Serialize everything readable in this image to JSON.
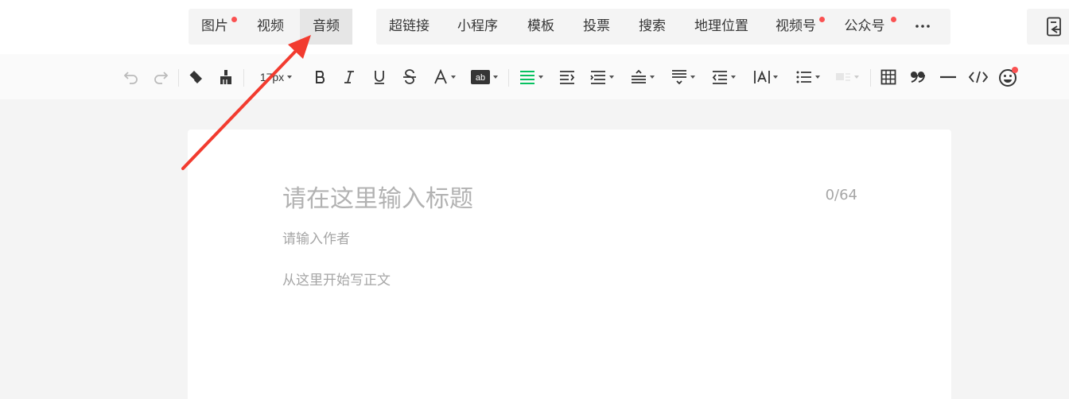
{
  "insert_bar": {
    "media_tabs": [
      {
        "label": "图片",
        "badge": true
      },
      {
        "label": "视频",
        "badge": false
      },
      {
        "label": "音频",
        "badge": false,
        "active": true
      }
    ],
    "more_tabs": [
      {
        "label": "超链接",
        "badge": false
      },
      {
        "label": "小程序",
        "badge": false
      },
      {
        "label": "模板",
        "badge": false
      },
      {
        "label": "投票",
        "badge": false
      },
      {
        "label": "搜索",
        "badge": false
      },
      {
        "label": "地理位置",
        "badge": false
      },
      {
        "label": "视频号",
        "badge": true
      },
      {
        "label": "公众号",
        "badge": true
      }
    ],
    "more_icon": "ellipsis-icon",
    "side_icon": "document-import-icon"
  },
  "toolbar": {
    "font_size": "17px",
    "icons": [
      "undo-icon",
      "redo-icon",
      "eraser-icon",
      "format-brush-icon",
      "bold-icon",
      "italic-icon",
      "underline-icon",
      "strikethrough-icon",
      "font-color-icon",
      "background-color-icon",
      "align-icon",
      "indent-icon",
      "line-height-icon",
      "paragraph-spacing-before-icon",
      "paragraph-spacing-after-icon",
      "first-line-indent-icon",
      "letter-spacing-icon",
      "list-icon",
      "float-icon",
      "table-icon",
      "quote-icon",
      "divider-icon",
      "code-icon",
      "emoji-icon"
    ]
  },
  "editor": {
    "title_placeholder": "请在这里输入标题",
    "title_count": "0/64",
    "author_placeholder": "请输入作者",
    "body_placeholder": "从这里开始写正文"
  },
  "colors": {
    "accent_green": "#07c160",
    "badge_red": "#fa5151",
    "annotation_red": "#f23b2f"
  }
}
